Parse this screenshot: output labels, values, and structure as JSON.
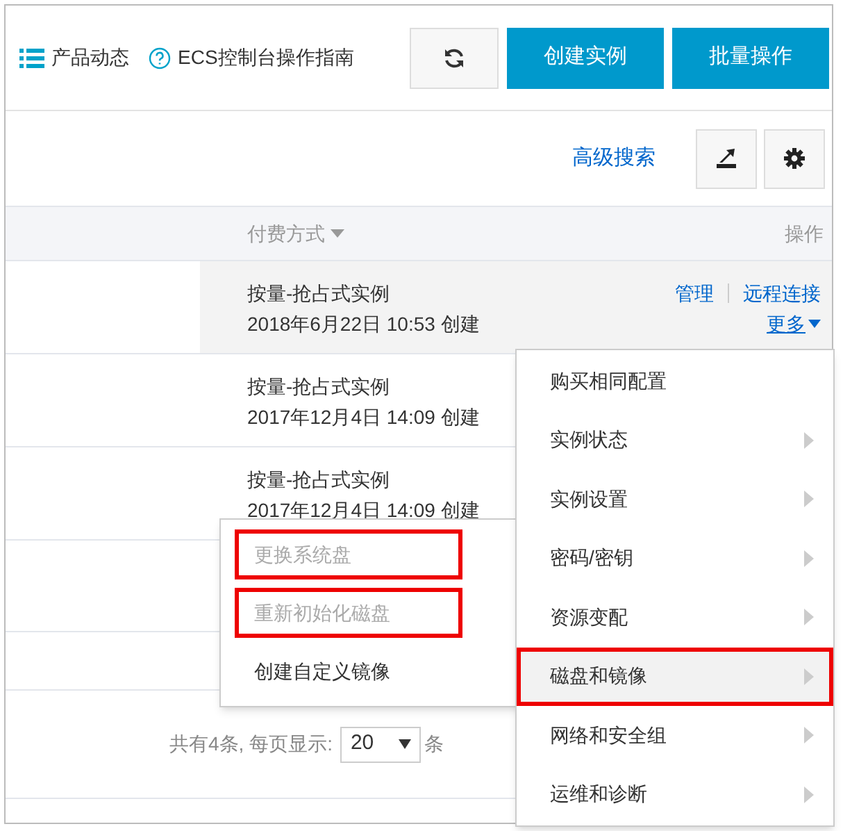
{
  "header_links": [
    {
      "kind": "list",
      "label": "产品动态"
    },
    {
      "kind": "help",
      "label": "ECS控制台操作指南"
    }
  ],
  "header_buttons": [
    {
      "kind": "refresh"
    },
    {
      "kind": "primary",
      "label": "创建实例"
    },
    {
      "kind": "primary",
      "label": "批量操作"
    }
  ],
  "toolbar": {
    "link": "高级搜索",
    "buttons": [
      {
        "kind": "export"
      },
      {
        "kind": "settings"
      }
    ]
  },
  "table": {
    "columns": [
      {
        "label": "付费方式",
        "sortable": true
      },
      {
        "label": "操作",
        "sortable": false
      }
    ],
    "rows": [
      {
        "billing": "按量-抢占式实例",
        "created": "2018年6月22日 10:53 创建",
        "hovered": true,
        "actions": [
          "管理",
          "远程连接"
        ],
        "more": "更多"
      },
      {
        "billing": "按量-抢占式实例",
        "created": "2017年12月4日 14:09 创建",
        "hovered": false
      },
      {
        "billing": "按量-抢占式实例",
        "created": "2017年12月4日 14:09 创建",
        "hovered": false
      }
    ]
  },
  "menu": {
    "items": [
      {
        "label": "购买相同配置",
        "has_submenu": false,
        "selected": false,
        "annotated": false
      },
      {
        "label": "实例状态",
        "has_submenu": true,
        "selected": false,
        "annotated": false
      },
      {
        "label": "实例设置",
        "has_submenu": true,
        "selected": false,
        "annotated": false
      },
      {
        "label": "密码/密钥",
        "has_submenu": true,
        "selected": false,
        "annotated": false
      },
      {
        "label": "资源变配",
        "has_submenu": true,
        "selected": false,
        "annotated": false
      },
      {
        "label": "磁盘和镜像",
        "has_submenu": true,
        "selected": true,
        "annotated": true
      },
      {
        "label": "网络和安全组",
        "has_submenu": true,
        "selected": false,
        "annotated": false
      },
      {
        "label": "运维和诊断",
        "has_submenu": true,
        "selected": false,
        "annotated": false
      }
    ]
  },
  "submenu": {
    "items": [
      {
        "label": "更换系统盘",
        "disabled": true,
        "annotated": true
      },
      {
        "label": "重新初始化磁盘",
        "disabled": true,
        "annotated": true
      },
      {
        "label": "创建自定义镜像",
        "disabled": false,
        "annotated": false
      }
    ]
  },
  "pagination": {
    "summary": "共有4条, 每页显示:",
    "page_size": "20",
    "unit": "条"
  }
}
